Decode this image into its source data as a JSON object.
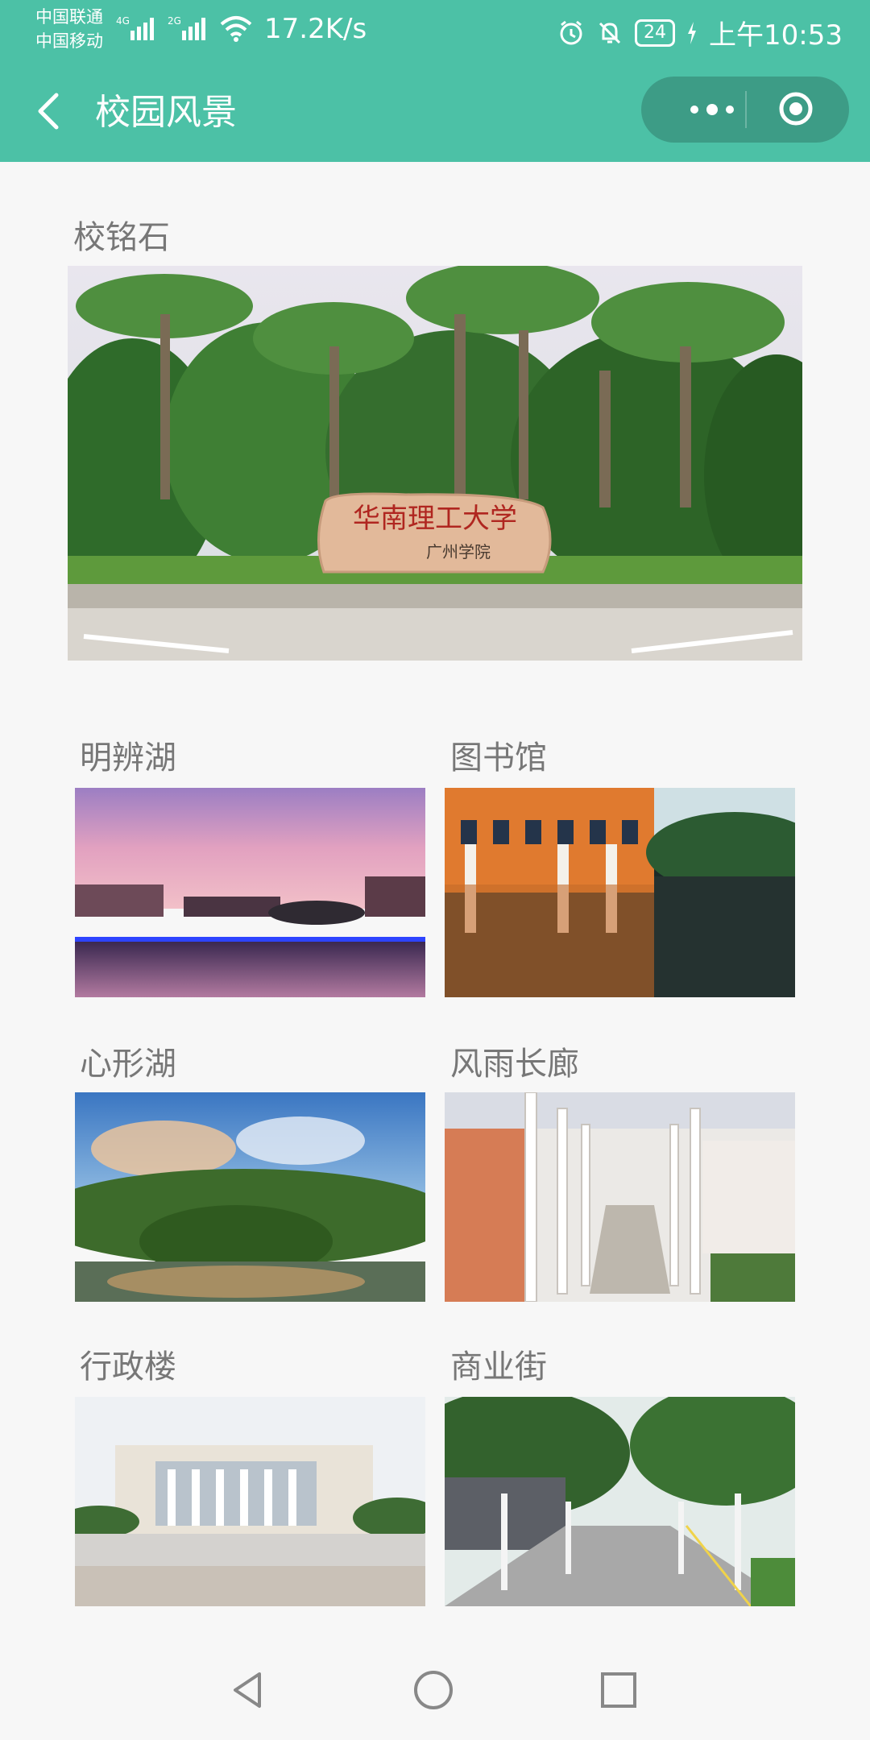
{
  "status_bar": {
    "carrier_1": "中国联通",
    "carrier_2": "中国移动",
    "net_1": "4G",
    "net_2": "2G",
    "speed": "17.2K/s",
    "battery": "24",
    "time": "上午10:53"
  },
  "nav": {
    "title": "校园风景"
  },
  "featured": {
    "title": "校铭石",
    "stone_line1": "华南理工大学",
    "stone_line2": "广州学院"
  },
  "grid": [
    {
      "title": "明辨湖"
    },
    {
      "title": "图书馆"
    },
    {
      "title": "心形湖"
    },
    {
      "title": "风雨长廊"
    },
    {
      "title": "行政楼"
    },
    {
      "title": "商业街"
    }
  ],
  "icons": {
    "back": "chevron-left-icon",
    "more": "more-dots-icon",
    "close": "target-circle-icon",
    "wifi": "wifi-icon",
    "alarm": "alarm-icon",
    "mute": "bell-off-icon",
    "charging": "bolt-icon",
    "nav_back": "triangle-back-icon",
    "nav_home": "circle-home-icon",
    "nav_recent": "square-recent-icon"
  },
  "colors": {
    "brand": "#4cc1a6",
    "capsule": "#3d9c86",
    "background": "#f7f7f7",
    "title_text": "#777777"
  }
}
